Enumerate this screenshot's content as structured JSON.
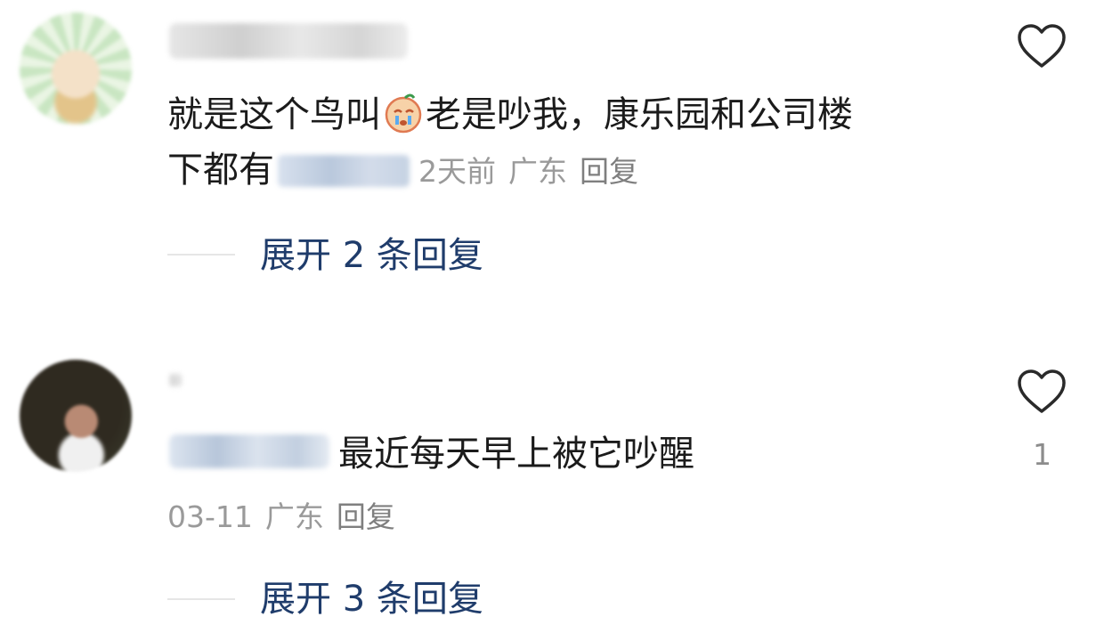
{
  "comments": [
    {
      "text_line1_a": "就是这个鸟叫",
      "emoji": "crying-face-emoji",
      "text_line1_b": "老是吵我，康乐园和公司楼",
      "text_line2": "下都有",
      "time": "2天前",
      "location": "广东",
      "reply_label": "回复",
      "expand_label": "展开 2 条回复"
    },
    {
      "text": "最近每天早上被它吵醒",
      "date": "03-11",
      "location": "广东",
      "reply_label": "回复",
      "expand_label": "展开 3 条回复",
      "like_count": "1"
    }
  ],
  "icons": {
    "like": "heart-outline-icon"
  },
  "colors": {
    "text": "#1b1b1b",
    "meta": "#9a9a9a",
    "link": "#1f3c6b"
  }
}
